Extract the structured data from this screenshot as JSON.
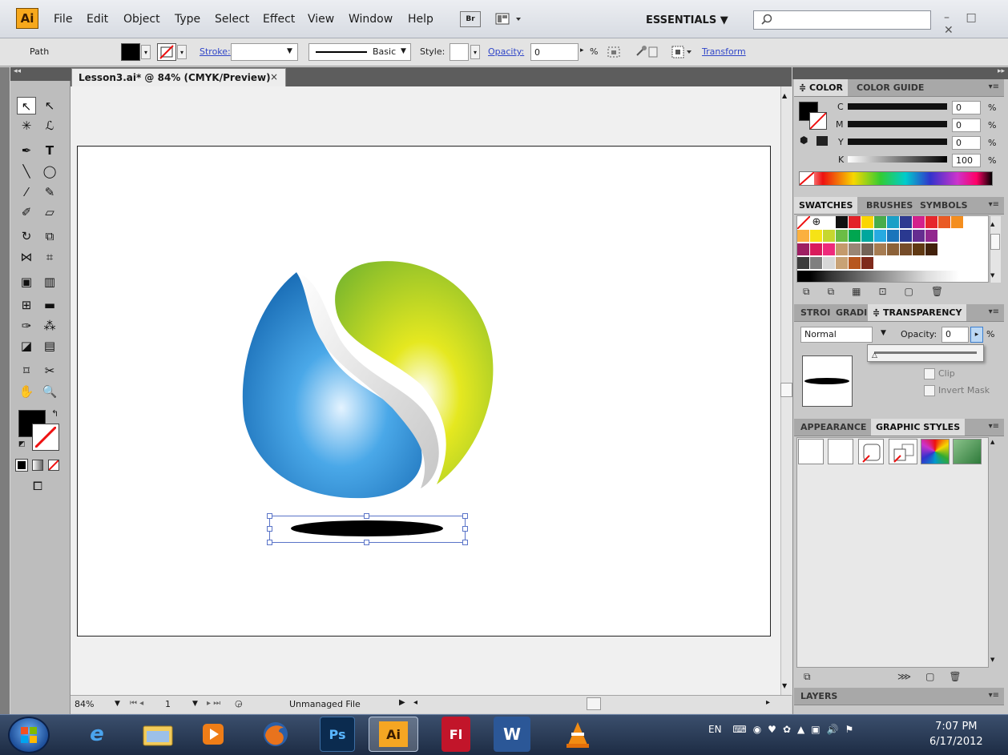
{
  "app": {
    "logo": "Ai",
    "menu": [
      "File",
      "Edit",
      "Object",
      "Type",
      "Select",
      "Effect",
      "View",
      "Window",
      "Help"
    ],
    "bridge_label": "Br",
    "workspace": "ESSENTIALS ▼",
    "window_controls": "– □ ✕"
  },
  "control_bar": {
    "selection_type": "Path",
    "stroke_label": "Stroke:",
    "brush_label": "Basic",
    "style_label": "Style:",
    "opacity_label": "Opacity:",
    "opacity_value": "0",
    "percent": "%",
    "transform_link": "Transform"
  },
  "document": {
    "tab_title": "Lesson3.ai* @ 84% (CMYK/Preview)",
    "close": "×"
  },
  "status": {
    "zoom": "84%",
    "artboard_num": "1",
    "file_status": "Unmanaged File"
  },
  "color_panel": {
    "tabs": [
      "≑ COLOR",
      "COLOR GUIDE"
    ],
    "channels": [
      {
        "label": "C",
        "value": "0",
        "level": 0.0
      },
      {
        "label": "M",
        "value": "0",
        "level": 0.0
      },
      {
        "label": "Y",
        "value": "0",
        "level": 0.0
      },
      {
        "label": "K",
        "value": "100",
        "level": 1.0
      }
    ],
    "unit": "%"
  },
  "swatches_panel": {
    "tabs": [
      "SWATCHES",
      "BRUSHES",
      "SYMBOLS"
    ],
    "row1": [
      "#ffffff",
      "#111111",
      "#e32229",
      "#fbd600",
      "#48ad4a",
      "#1ba0c7",
      "#2e3a91",
      "#d4208c",
      "#e6262c",
      "#ea5a24",
      "#f48e1f"
    ],
    "row2": [
      "#fbb03f",
      "#f6e316",
      "#c6d72f",
      "#6bbd45",
      "#00a650",
      "#00a79d",
      "#27aae1",
      "#1b75bb",
      "#2a3990",
      "#652d90",
      "#92278f"
    ],
    "row3": [
      "#9e1f63",
      "#d91c5c",
      "#ee2a7b",
      "#c49a6c",
      "#998675",
      "#736357",
      "#a67c52",
      "#8c6239",
      "#754c29",
      "#603913",
      "#42210b"
    ],
    "row4": [
      "#3c3c3c",
      "#7f7f7f",
      "#d7d7d7",
      "#c8a276",
      "#b7571f",
      "#7f2a1b"
    ]
  },
  "transparency_panel": {
    "tabs": [
      "STROI",
      "GRADI",
      "≑ TRANSPARENCY"
    ],
    "blend_mode": "Normal",
    "opacity_label": "Opacity:",
    "opacity_value": "0",
    "unit": "%",
    "clip_label": "Clip",
    "invert_mask_label": "Invert Mask"
  },
  "graphic_styles_panel": {
    "tabs": [
      "APPEARANCE",
      "GRAPHIC STYLES"
    ]
  },
  "layers_panel": {
    "title": "LAYERS"
  },
  "taskbar": {
    "apps": [
      "IE",
      "Explorer",
      "Media",
      "Firefox",
      "Ps",
      "Ai",
      "Fl",
      "W",
      "VLC"
    ],
    "language": "EN",
    "time": "7:07 PM",
    "date": "6/17/2012"
  }
}
